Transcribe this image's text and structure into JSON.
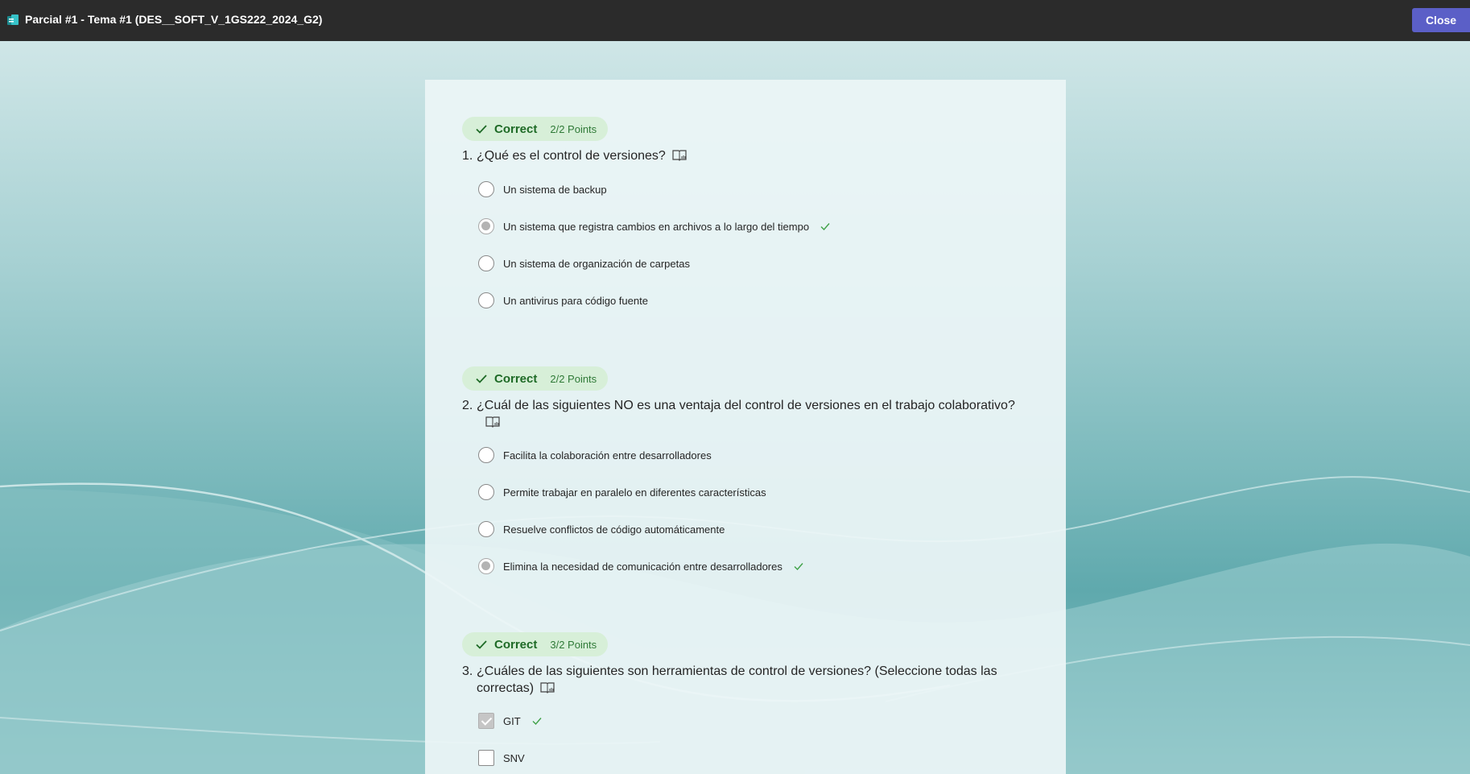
{
  "window": {
    "title": "Parcial #1 - Tema #1 (DES__SOFT_V_1GS222_2024_G2)",
    "close_label": "Close"
  },
  "colors": {
    "accent": "#5b5fc7",
    "correct_bg": "#d7efd8",
    "correct_text": "#1e6a26",
    "check_mark": "#3fa147"
  },
  "questions": [
    {
      "result": "Correct",
      "points": "2/2 Points",
      "number": "1.",
      "text": "¿Qué es el control de versiones?",
      "type": "radio",
      "options": [
        {
          "label": "Un sistema de backup",
          "selected": false,
          "correct": false
        },
        {
          "label": "Un sistema que registra cambios en archivos a lo largo del tiempo",
          "selected": true,
          "correct": true
        },
        {
          "label": "Un sistema de organización de carpetas",
          "selected": false,
          "correct": false
        },
        {
          "label": "Un antivirus para código fuente",
          "selected": false,
          "correct": false
        }
      ]
    },
    {
      "result": "Correct",
      "points": "2/2 Points",
      "number": "2.",
      "text": "¿Cuál de las siguientes NO es una ventaja del control de versiones en el trabajo colaborativo?",
      "type": "radio",
      "options": [
        {
          "label": "Facilita la colaboración entre desarrolladores",
          "selected": false,
          "correct": false
        },
        {
          "label": "Permite trabajar en paralelo en diferentes características",
          "selected": false,
          "correct": false
        },
        {
          "label": "Resuelve conflictos de código automáticamente",
          "selected": false,
          "correct": false
        },
        {
          "label": "Elimina la necesidad de comunicación entre desarrolladores",
          "selected": true,
          "correct": true
        }
      ]
    },
    {
      "result": "Correct",
      "points": "3/2 Points",
      "number": "3.",
      "text": "¿Cuáles de las siguientes son herramientas de control de versiones? (Seleccione todas las correctas)",
      "type": "checkbox",
      "options": [
        {
          "label": "GIT",
          "selected": true,
          "correct": true
        },
        {
          "label": "SNV",
          "selected": false,
          "correct": false
        }
      ]
    }
  ]
}
